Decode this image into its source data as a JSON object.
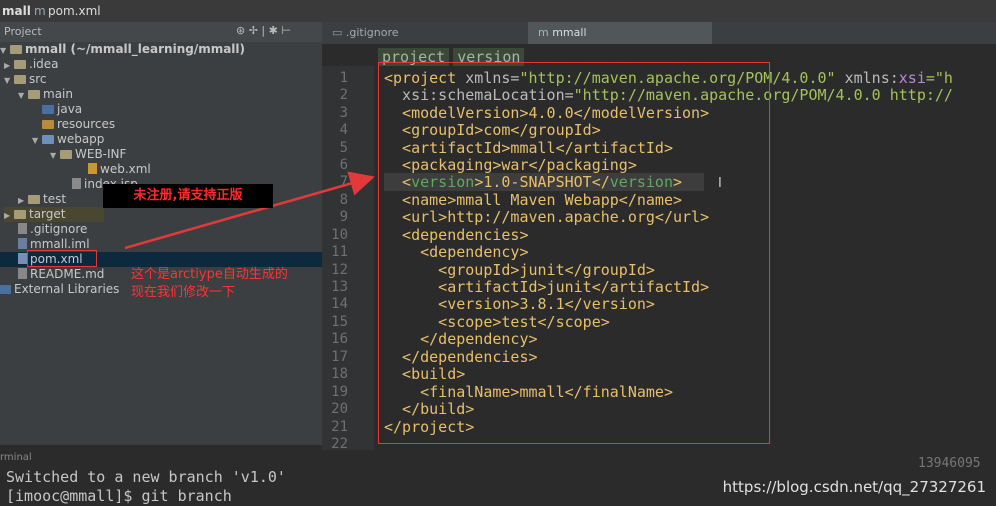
{
  "breadcrumb": {
    "project": "mall",
    "file": "pom.xml"
  },
  "project_panel": {
    "title": "Project",
    "items": [
      {
        "label": "mmall (~/mmall_learning/mmall)",
        "depth": 0,
        "kind": "module"
      },
      {
        "label": ".idea",
        "depth": 1,
        "kind": "folder"
      },
      {
        "label": "src",
        "depth": 1,
        "kind": "folder"
      },
      {
        "label": "main",
        "depth": 2,
        "kind": "folder"
      },
      {
        "label": "java",
        "depth": 3,
        "kind": "src-folder"
      },
      {
        "label": "resources",
        "depth": 3,
        "kind": "res-folder"
      },
      {
        "label": "webapp",
        "depth": 3,
        "kind": "folder"
      },
      {
        "label": "WEB-INF",
        "depth": 4,
        "kind": "folder"
      },
      {
        "label": "web.xml",
        "depth": 5,
        "kind": "xml"
      },
      {
        "label": "index.jsp",
        "depth": 4,
        "kind": "jsp"
      },
      {
        "label": "test",
        "depth": 2,
        "kind": "folder"
      },
      {
        "label": "target",
        "depth": 1,
        "kind": "folder"
      },
      {
        "label": ".gitignore",
        "depth": 1,
        "kind": "file"
      },
      {
        "label": "mmall.iml",
        "depth": 1,
        "kind": "iml"
      },
      {
        "label": "pom.xml",
        "depth": 1,
        "kind": "maven"
      },
      {
        "label": "README.md",
        "depth": 1,
        "kind": "md"
      },
      {
        "label": "External Libraries",
        "depth": 0,
        "kind": "lib"
      }
    ]
  },
  "tabs": [
    {
      "label": ".gitignore",
      "active": false
    },
    {
      "label": "mmall",
      "active": true
    }
  ],
  "editor_breadcrumb": [
    "project",
    "version"
  ],
  "line_numbers": [
    "1",
    "2",
    "3",
    "4",
    "5",
    "6",
    "7",
    "8",
    "9",
    "10",
    "11",
    "12",
    "13",
    "14",
    "15",
    "16",
    "17",
    "18",
    "19",
    "20",
    "21",
    "22"
  ],
  "code": {
    "l1": [
      "<project ",
      "xmlns=",
      "\"http://maven.apache.org/POM/4.0.0\"",
      " xmlns:",
      "xsi",
      "=\"h"
    ],
    "l2": [
      "  xsi:schemaLocation=",
      "\"http://maven.apache.org/POM/4.0.0 http://"
    ],
    "l3": "  <modelVersion>4.0.0</modelVersion>",
    "l4": "  <groupId>com</groupId>",
    "l5": "  <artifactId>mmall</artifactId>",
    "l6": "  <packaging>war</packaging>",
    "l7": [
      "  <",
      "version",
      ">1.0-SNAPSHOT</",
      "version",
      ">"
    ],
    "l8": "  <name>mmall Maven Webapp</name>",
    "l9": "  <url>http://maven.apache.org</url>",
    "l10": "  <dependencies>",
    "l11": "    <dependency>",
    "l12": "      <groupId>junit</groupId>",
    "l13": "      <artifactId>junit</artifactId>",
    "l14": "      <version>3.8.1</version>",
    "l15": "      <scope>test</scope>",
    "l16": "    </dependency>",
    "l17": "  </dependencies>",
    "l18": "  <build>",
    "l19": "    <finalName>mmall</finalName>",
    "l20": "  </build>",
    "l21": "</project>",
    "l22": ""
  },
  "watermark": "未注册,请支持正版",
  "annotation": [
    "这个是arctiype自动生成的",
    "现在我们修改一下"
  ],
  "terminal": {
    "label": "rminal",
    "lines": [
      "Switched to a new branch 'v1.0'",
      "[imooc@mmall]$ git branch"
    ]
  },
  "corner_code": "13946095",
  "csdn_url": "https://blog.csdn.net/qq_27327261",
  "colors": {
    "annotation_red": "#e23a3a",
    "tag": "#e8bf6a",
    "string": "#a5c25c"
  }
}
